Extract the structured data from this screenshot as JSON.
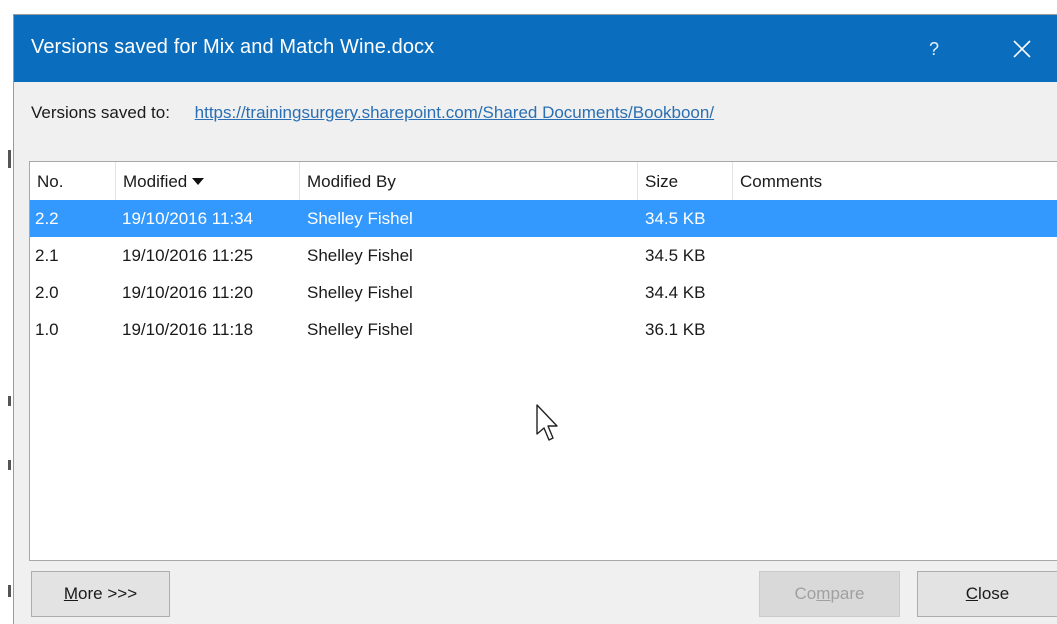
{
  "dialog": {
    "title": "Versions saved for Mix and Match Wine.docx",
    "help_label": "?",
    "saved_to_label": "Versions saved to:",
    "saved_to_url": "https://trainingsurgery.sharepoint.com/Shared Documents/Bookboon/"
  },
  "table": {
    "columns": [
      "No.",
      "Modified",
      "Modified By",
      "Size",
      "Comments"
    ],
    "sorted_column": "Modified",
    "sort_direction": "descending",
    "rows": [
      {
        "no": "2.2",
        "modified": "19/10/2016 11:34",
        "modified_by": "Shelley Fishel",
        "size": "34.5 KB",
        "comments": "",
        "selected": true
      },
      {
        "no": "2.1",
        "modified": "19/10/2016 11:25",
        "modified_by": "Shelley Fishel",
        "size": "34.5 KB",
        "comments": "",
        "selected": false
      },
      {
        "no": "2.0",
        "modified": "19/10/2016 11:20",
        "modified_by": "Shelley Fishel",
        "size": "34.4 KB",
        "comments": "",
        "selected": false
      },
      {
        "no": "1.0",
        "modified": "19/10/2016 11:18",
        "modified_by": "Shelley Fishel",
        "size": "36.1 KB",
        "comments": "",
        "selected": false
      }
    ]
  },
  "buttons": {
    "more": {
      "mnemonic": "M",
      "rest": "ore >>>"
    },
    "compare": {
      "pre": "Co",
      "mnemonic": "m",
      "rest": "pare",
      "enabled": false
    },
    "close": {
      "mnemonic": "C",
      "rest": "lose"
    }
  },
  "icons": {
    "close": "close-icon",
    "sort": "sort-descending-icon",
    "cursor": "mouse-pointer-icon"
  },
  "colors": {
    "titlebar": "#0a6dbd",
    "selection": "#3399ff",
    "link": "#2a6fb3",
    "dialog_bg": "#f0f0f0"
  }
}
